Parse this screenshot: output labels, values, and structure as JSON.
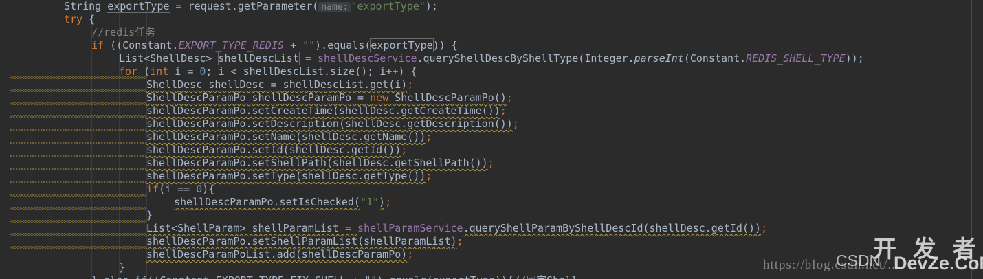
{
  "code_lines": [
    {
      "indent": 93,
      "tokens": [
        [
          "String ",
          ""
        ],
        [
          "exportType",
          "paren"
        ],
        [
          " = request.getParameter(",
          ""
        ],
        [
          "name:",
          "hint"
        ],
        [
          "\"exportType\"",
          "str"
        ],
        [
          ");",
          ""
        ]
      ]
    },
    {
      "indent": 93,
      "tokens": [
        [
          "try",
          "kw"
        ],
        [
          " {",
          ""
        ]
      ]
    },
    {
      "indent": 133,
      "tokens": [
        [
          "//redis任务",
          "cm"
        ]
      ]
    },
    {
      "indent": 133,
      "tokens": [
        [
          "if",
          "kw"
        ],
        [
          " ((Constant.",
          ""
        ],
        [
          "EXPORT_TYPE_REDIS",
          "fld"
        ],
        [
          " + ",
          ""
        ],
        [
          "\"\"",
          "str"
        ],
        [
          ").equals(",
          ""
        ],
        [
          "exportType",
          "paren"
        ],
        [
          ")) {",
          ""
        ]
      ]
    },
    {
      "indent": 173,
      "tokens": [
        [
          "List<ShellDesc> ",
          ""
        ],
        [
          "shellDescList",
          "paren"
        ],
        [
          " = ",
          ""
        ],
        [
          "shellDescService",
          "ifld"
        ],
        [
          ".queryShellDescByShellType(Integer.",
          ""
        ],
        [
          "parseInt",
          "it"
        ],
        [
          "(Constant.",
          ""
        ],
        [
          "REDIS_SHELL_TYPE",
          "fld"
        ],
        [
          "));",
          ""
        ]
      ]
    },
    {
      "indent": 173,
      "tokens": [
        [
          "for",
          "kw"
        ],
        [
          " (",
          ""
        ],
        [
          "int",
          "kw"
        ],
        [
          " i = ",
          ""
        ],
        [
          "0",
          "num"
        ],
        [
          "; i < shellDescList.size(); i++) {",
          ""
        ]
      ]
    },
    {
      "indent": 213,
      "tokens": [
        [
          "ShellDesc shellDesc = shellDescList.get(i)",
          "warn"
        ],
        [
          ";",
          "kw"
        ]
      ]
    },
    {
      "indent": 213,
      "tokens": [
        [
          "ShellDescParamPo shellDescParamPo = ",
          "warn"
        ],
        [
          "new",
          "kw warn"
        ],
        [
          " ShellDescParamPo()",
          "warn"
        ],
        [
          ";",
          "kw"
        ]
      ]
    },
    {
      "indent": 213,
      "tokens": [
        [
          "shellDescParamPo.setCreateTime(shellDesc.getCreateTime())",
          "warn"
        ],
        [
          ";",
          "kw"
        ]
      ]
    },
    {
      "indent": 213,
      "tokens": [
        [
          "shellDescParamPo.setDescription(shellDesc.getDescription())",
          "warn"
        ],
        [
          ";",
          "kw"
        ]
      ]
    },
    {
      "indent": 213,
      "tokens": [
        [
          "shellDescParamPo.setName(shellDesc.getName())",
          "warn"
        ],
        [
          ";",
          "kw"
        ]
      ]
    },
    {
      "indent": 213,
      "tokens": [
        [
          "shellDescParamPo.setId(shellDesc.getId())",
          "warn"
        ],
        [
          ";",
          "kw"
        ]
      ]
    },
    {
      "indent": 213,
      "tokens": [
        [
          "shellDescParamPo.setShellPath(shellDesc.getShellPath())",
          "warn"
        ],
        [
          ";",
          "kw"
        ]
      ]
    },
    {
      "indent": 213,
      "tokens": [
        [
          "shellDescParamPo.setType(shellDesc.getType())",
          "warn"
        ],
        [
          ";",
          "kw"
        ]
      ]
    },
    {
      "indent": 213,
      "tokens": [
        [
          "if",
          "kw"
        ],
        [
          "(i == ",
          ""
        ],
        [
          "0",
          "num"
        ],
        [
          "){",
          ""
        ]
      ]
    },
    {
      "indent": 253,
      "tokens": [
        [
          "shellDescParamPo.setIsChecked(",
          "warn"
        ],
        [
          "\"1\"",
          "str"
        ],
        [
          ")",
          "warn"
        ],
        [
          ";",
          "kw"
        ]
      ]
    },
    {
      "indent": 213,
      "tokens": [
        [
          "}",
          ""
        ]
      ]
    },
    {
      "indent": 213,
      "tokens": [
        [
          "List<ShellParam> shellParamList = ",
          "warn"
        ],
        [
          "shellParamService",
          "ifld"
        ],
        [
          ".queryShellParamByShellDescId(shellDesc.getId())",
          "warn"
        ],
        [
          ";",
          "kw"
        ]
      ]
    },
    {
      "indent": 213,
      "tokens": [
        [
          "shellDescParamPo.setShellParamList(shellParamList)",
          "warn"
        ],
        [
          ";",
          "kw"
        ]
      ]
    },
    {
      "indent": 213,
      "tokens": [
        [
          "shellDescParamPoList.add(shellDescParamPo)",
          "warn"
        ],
        [
          ";",
          "kw"
        ]
      ]
    },
    {
      "indent": 173,
      "tokens": [
        [
          "}",
          ""
        ]
      ]
    },
    {
      "indent": 133,
      "tokens": [
        [
          "} else if((Constant.EXPORT_TYPE_FIX_SHELL + \"\").equals(exportType)){//固定Shell",
          ""
        ]
      ]
    }
  ],
  "colors": {
    "background": "#2b2b2b",
    "keyword": "#cc7832",
    "string": "#6a8759",
    "comment": "#808080",
    "field": "#9876aa",
    "number": "#6897bb",
    "text": "#a9b7c6"
  },
  "watermark": {
    "url": "https://blog.csdn.net/...",
    "csdn": "CSDN",
    "site_cn": "开 发 者",
    "site_en": "DevZe.CoM"
  }
}
